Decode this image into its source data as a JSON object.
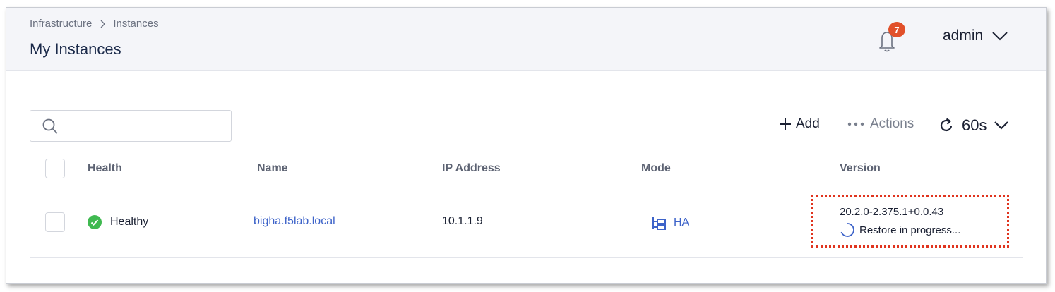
{
  "breadcrumb": {
    "items": [
      "Infrastructure",
      "Instances"
    ],
    "separator": ">"
  },
  "page": {
    "title": "My Instances"
  },
  "notifications": {
    "count": "7"
  },
  "user": {
    "name": "admin"
  },
  "search": {
    "placeholder": ""
  },
  "toolbar": {
    "add_label": "Add",
    "actions_label": "Actions",
    "refresh_interval": "60s"
  },
  "table": {
    "columns": [
      "Health",
      "Name",
      "IP Address",
      "Mode",
      "Version"
    ],
    "rows": [
      {
        "health": "Healthy",
        "name": "bigha.f5lab.local",
        "ip": "10.1.1.9",
        "mode": "HA",
        "version": "20.2.0-2.375.1+0.0.43",
        "status": "Restore in progress..."
      }
    ]
  },
  "colors": {
    "accent": "#3d63c9",
    "badge": "#e1502a",
    "healthy": "#3fb950",
    "highlight_border": "#e0341e",
    "header_bg": "#f4f5f9"
  },
  "icons": [
    "chevron-right-icon",
    "bell-icon",
    "chevron-down-icon",
    "search-icon",
    "plus-icon",
    "more-dots-icon",
    "refresh-icon",
    "check-circle-icon",
    "ha-mode-icon",
    "spinner-icon"
  ]
}
